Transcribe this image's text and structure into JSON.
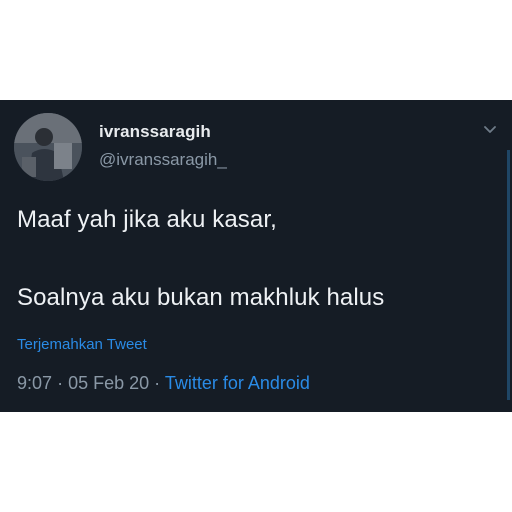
{
  "tweet": {
    "display_name": "ivranssaragih",
    "handle": "@ivranssaragih_",
    "text_line1": "Maaf yah jika aku kasar,",
    "text_line2": "Soalnya aku bukan makhluk halus",
    "translate_label": "Terjemahkan Tweet",
    "time": "9:07",
    "separator": "·",
    "date": "05 Feb 20",
    "source": "Twitter for Android"
  },
  "icons": {
    "menu": "chevron-down-icon",
    "avatar": "profile-photo"
  },
  "colors": {
    "card_background": "#151c25",
    "link_blue": "#2a8be6",
    "secondary_text": "#8a98a6",
    "primary_text": "#eef1f4"
  }
}
